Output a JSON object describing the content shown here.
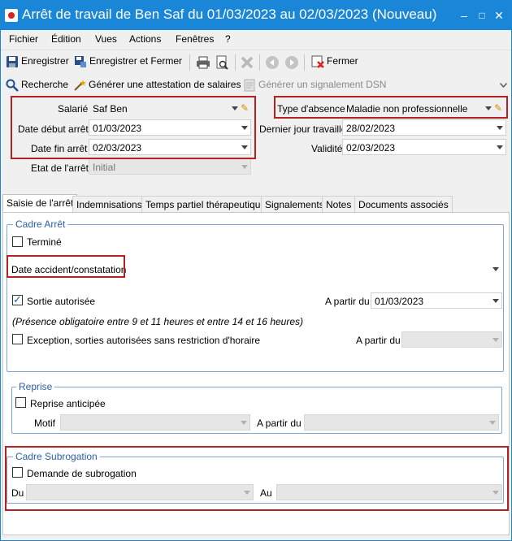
{
  "window": {
    "title": "Arrêt de travail de Ben Saf du 01/03/2023 au 02/03/2023 (Nouveau)",
    "controls": {
      "minimize": "–",
      "maximize": "□",
      "close": "✕"
    }
  },
  "menu": [
    "Fichier",
    "Édition",
    "Vues",
    "Actions",
    "Fenêtres",
    "?"
  ],
  "toolbar": {
    "save": "Enregistrer",
    "save_close": "Enregistrer et Fermer",
    "close": "Fermer"
  },
  "toolbar2": {
    "search": "Recherche",
    "generate_attestation": "Générer une attestation de salaires",
    "generate_dsn": "Générer un signalement DSN"
  },
  "form": {
    "salarie_label": "Salarié",
    "salarie_value": "Saf Ben",
    "date_debut_label": "Date début arrêt",
    "date_debut_value": "01/03/2023",
    "date_fin_label": "Date fin arrêt",
    "date_fin_value": "02/03/2023",
    "etat_label": "Etat de l'arrêt",
    "etat_value": "Initial",
    "type_absence_label": "Type d'absence",
    "type_absence_value": "Maladie non professionnelle",
    "dernier_jour_label": "Dernier jour travaillé",
    "dernier_jour_value": "28/02/2023",
    "validite_label": "Validité",
    "validite_value": "02/03/2023"
  },
  "tabs": [
    "Saisie de l'arrêt",
    "Indemnisations",
    "Temps partiel thérapeutique",
    "Signalements",
    "Notes",
    "Documents associés"
  ],
  "cadre_arret": {
    "title": "Cadre Arrêt",
    "termine_label": "Terminé",
    "date_accident_label": "Date accident/constatation",
    "sortie_label": "Sortie autorisée",
    "sortie_partir_label": "A partir du",
    "sortie_partir_value": "01/03/2023",
    "presence_note": "(Présence obligatoire entre 9 et 11 heures et entre 14 et 16 heures)",
    "exception_label": "Exception, sorties autorisées sans restriction d'horaire",
    "exception_partir_label": "A partir du"
  },
  "reprise": {
    "title": "Reprise",
    "anticipee_label": "Reprise anticipée",
    "motif_label": "Motif",
    "partir_label": "A partir du"
  },
  "subrogation": {
    "title": "Cadre Subrogation",
    "demande_label": "Demande de subrogation",
    "du_label": "Du",
    "au_label": "Au"
  },
  "colors": {
    "titlebar": "#1a86d8",
    "highlight_box": "#b22222",
    "group_border": "#7ea7d8"
  }
}
